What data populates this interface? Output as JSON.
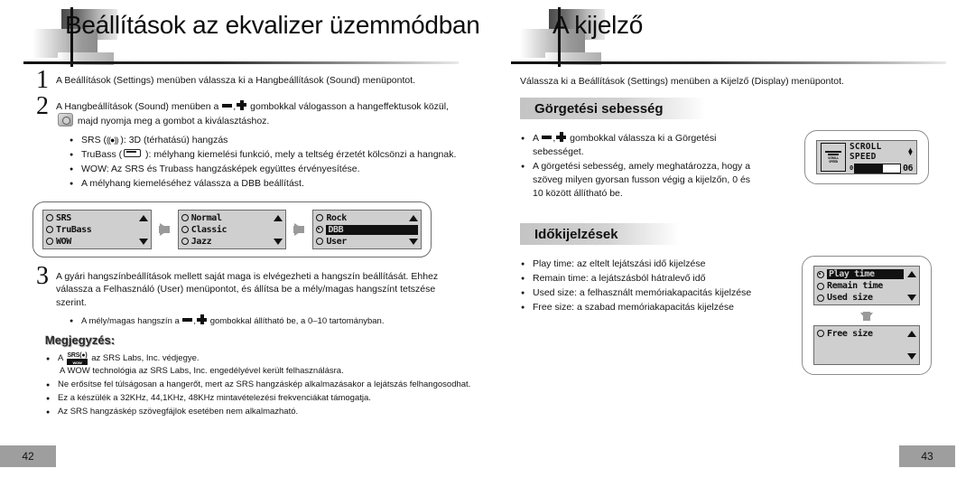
{
  "left_page": {
    "title": "Beállítások az ekvalizer üzemmódban",
    "page_number": "42",
    "steps": [
      {
        "num": "1",
        "text_a": "A Beállítások (Settings) menüben válassza ki a Hangbeállítások (Sound) menüpontot.",
        "text_b": ""
      },
      {
        "num": "2",
        "text_a": "A Hangbeállítások (Sound) menüben a ",
        "text_b": " gombokkal válogasson a hangeffektusok közül, ",
        "text_c": " majd nyomja meg a  gombot a kiválasztáshoz."
      },
      {
        "num": "3",
        "text_a": "A gyári hangszínbeállítások mellett saját maga is elvégezheti a hangszín beállítását. Ehhez válassza a Felhasználó (User) menüpontot, és állítsa be a mély/magas hangszínt tetszése szerint.",
        "text_b": ""
      }
    ],
    "step2_bullets": [
      {
        "pre": "SRS (",
        "icon": "srs-waves-icon",
        "post": " ): 3D (térhatású) hangzás"
      },
      {
        "pre": "TruBass (",
        "icon": "trubass-bar-icon",
        "post": " ): mélyhang kiemelési funkció, mely a teltség érzetét kölcsönzi a hangnak."
      },
      {
        "pre": "",
        "icon": "",
        "post": "WOW: Az SRS és Trubass hangzásképek együttes érvényesítése."
      },
      {
        "pre": "",
        "icon": "",
        "post": "A mélyhang kiemeléséhez válassza a DBB beállítást."
      }
    ],
    "step3_bullet": {
      "pre": "A mély/magas hangszín a ",
      "post": " gombokkal állítható be, a 0–10 tartományban."
    },
    "note_title": "Megjegyzés:",
    "notes": [
      "az SRS Labs, Inc. védjegye.",
      "A WOW technológia az SRS Labs, Inc. engedélyével került felhasználásra.",
      "Ne erősítse fel túlságosan a hangerőt, mert az SRS hangzáskép alkalmazásakor a lejátszás felhangosodhat.",
      "Ez a készülék a 32KHz, 44,1KHz, 48KHz mintavételezési frekvenciákat támogatja.",
      "Az SRS hangzáskép szövegfájlok esetében nem alkalmazható."
    ],
    "note_prefix": "A",
    "srs_logo": {
      "top": "SRS(●)",
      "bottom": "WOW"
    },
    "diagram": {
      "screens": [
        {
          "name": "sound-effect-list",
          "rows": [
            {
              "label": "SRS",
              "selected": false,
              "checked": false,
              "arrow": "up"
            },
            {
              "label": "TruBass",
              "selected": false,
              "checked": false,
              "arrow": ""
            },
            {
              "label": "WOW",
              "selected": false,
              "checked": false,
              "arrow": "down"
            }
          ]
        },
        {
          "name": "preset-list-1",
          "rows": [
            {
              "label": "Normal",
              "selected": false,
              "checked": false,
              "arrow": "up"
            },
            {
              "label": "Classic",
              "selected": false,
              "checked": false,
              "arrow": ""
            },
            {
              "label": "Jazz",
              "selected": false,
              "checked": false,
              "arrow": "down"
            }
          ]
        },
        {
          "name": "preset-list-2",
          "rows": [
            {
              "label": "Rock",
              "selected": false,
              "checked": false,
              "arrow": "up"
            },
            {
              "label": "DBB",
              "selected": true,
              "checked": true,
              "arrow": ""
            },
            {
              "label": "User",
              "selected": false,
              "checked": false,
              "arrow": "down"
            }
          ]
        }
      ]
    }
  },
  "right_page": {
    "title": "A kijelző",
    "page_number": "43",
    "lead": "Válassza ki a Beállítások (Settings) menüben a Kijelző (Display) menüpontot.",
    "sections": [
      {
        "heading": "Görgetési sebesség",
        "bullets": [
          {
            "pre": "A ",
            "post": " gombokkal válassza ki a Görgetési sebességet."
          },
          {
            "pre": "",
            "post": "A görgetési sebesség, amely meghatározza, hogy a szöveg milyen gyorsan fusson végig a kijelzőn, 0 és 10 között állítható be."
          }
        ],
        "lcd": {
          "name": "scroll-speed-lcd",
          "icon_label_top": "SCROLL",
          "icon_label_bottom": "SPEED",
          "title": "SCROLL SPEED",
          "value": "06",
          "fill_percent": 62,
          "bar_prefix": "0"
        }
      },
      {
        "heading": "Időkijelzések",
        "bullets": [
          {
            "pre": "",
            "post": "Play time: az eltelt lejátszási idő kijelzése"
          },
          {
            "pre": "",
            "post": "Remain time: a lejátszásból hátralevő idő"
          },
          {
            "pre": "",
            "post": "Used size: a felhasznált memóriakapacitás kijelzése"
          },
          {
            "pre": "",
            "post": "Free size: a szabad memóriakapacitás kijelzése"
          }
        ],
        "lcd_screens": [
          {
            "name": "time-display-list",
            "rows": [
              {
                "label": "Play time",
                "selected": true,
                "checked": true,
                "arrow": "up"
              },
              {
                "label": "Remain time",
                "selected": false,
                "checked": false,
                "arrow": ""
              },
              {
                "label": "Used size",
                "selected": false,
                "checked": false,
                "arrow": "down"
              }
            ]
          },
          {
            "name": "free-size-list",
            "rows": [
              {
                "label": "Free size",
                "selected": false,
                "checked": false,
                "arrow": "up"
              },
              {
                "label": "",
                "selected": false,
                "checked": false,
                "arrow": ""
              },
              {
                "label": "",
                "selected": false,
                "checked": false,
                "arrow": "down"
              }
            ]
          }
        ]
      }
    ]
  },
  "colors": {
    "lcd_bg": "#cfcfcf",
    "lcd_border": "#6b6b6b",
    "pagenum_bg": "#9e9e9e",
    "rule": "#111111",
    "arrow_gray": "#9a9a9a"
  }
}
